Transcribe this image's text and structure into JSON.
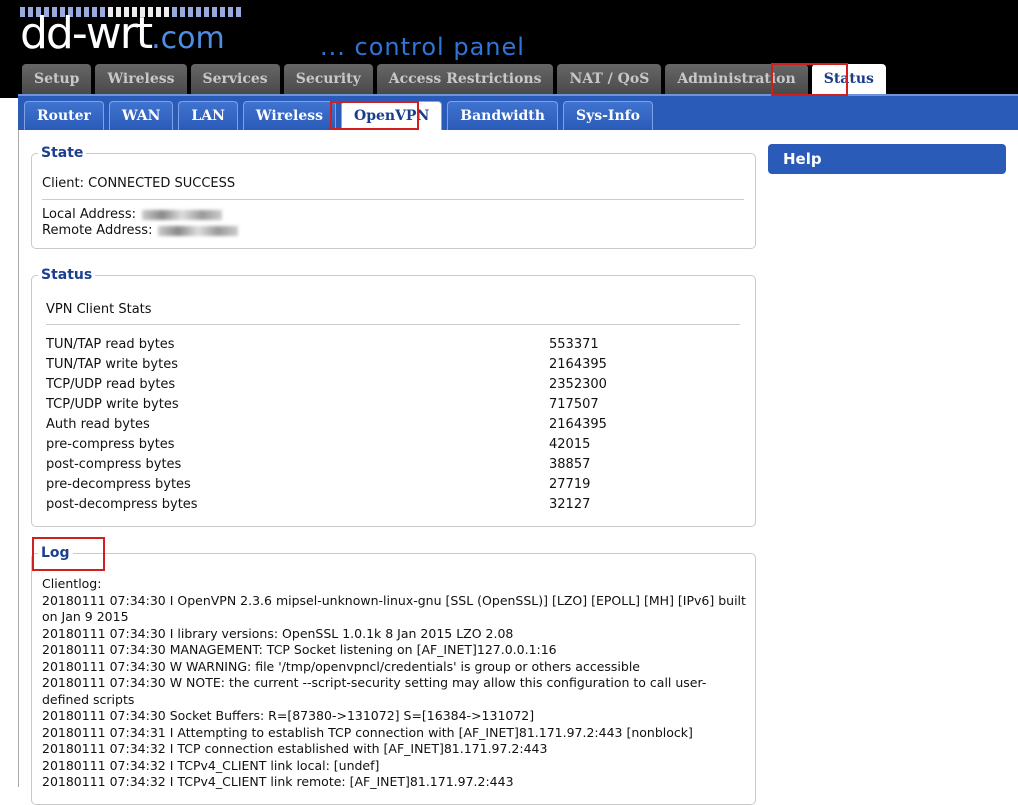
{
  "brand": {
    "logo_main": "dd-wrt",
    "logo_suffix": ".com",
    "tagline": "... control panel",
    "colors": {
      "header_bg": "#000000",
      "nav_blue": "#2b5bb8",
      "highlight_red": "#d01f1f",
      "legend_blue": "#1c3f8f"
    }
  },
  "top_tabs": [
    "Setup",
    "Wireless",
    "Services",
    "Security",
    "Access Restrictions",
    "NAT / QoS",
    "Administration",
    "Status"
  ],
  "top_active": "Status",
  "sub_tabs": [
    "Router",
    "WAN",
    "LAN",
    "Wireless",
    "OpenVPN",
    "Bandwidth",
    "Sys-Info"
  ],
  "sub_active": "OpenVPN",
  "state": {
    "legend": "State",
    "client": "Client: CONNECTED SUCCESS",
    "local_label": "Local Address:",
    "remote_label": "Remote Address:"
  },
  "status": {
    "legend": "Status",
    "heading": "VPN Client Stats",
    "rows": [
      {
        "label": "TUN/TAP read bytes",
        "value": "553371"
      },
      {
        "label": "TUN/TAP write bytes",
        "value": "2164395"
      },
      {
        "label": "TCP/UDP read bytes",
        "value": "2352300"
      },
      {
        "label": "TCP/UDP write bytes",
        "value": "717507"
      },
      {
        "label": "Auth read bytes",
        "value": "2164395"
      },
      {
        "label": "pre-compress bytes",
        "value": "42015"
      },
      {
        "label": "post-compress bytes",
        "value": "38857"
      },
      {
        "label": "pre-decompress bytes",
        "value": "27719"
      },
      {
        "label": "post-decompress bytes",
        "value": "32127"
      }
    ]
  },
  "log": {
    "legend": "Log",
    "title": "Clientlog:",
    "lines": [
      "20180111 07:34:30 I OpenVPN 2.3.6 mipsel-unknown-linux-gnu [SSL (OpenSSL)] [LZO] [EPOLL] [MH] [IPv6] built on Jan 9 2015",
      "20180111 07:34:30 I library versions: OpenSSL 1.0.1k 8 Jan 2015 LZO 2.08",
      "20180111 07:34:30 MANAGEMENT: TCP Socket listening on [AF_INET]127.0.0.1:16",
      "20180111 07:34:30 W WARNING: file '/tmp/openvpncl/credentials' is group or others accessible",
      "20180111 07:34:30 W NOTE: the current --script-security setting may allow this configuration to call user-defined scripts",
      "20180111 07:34:30 Socket Buffers: R=[87380->131072] S=[16384->131072]",
      "20180111 07:34:31 I Attempting to establish TCP connection with [AF_INET]81.171.97.2:443 [nonblock]",
      "20180111 07:34:32 I TCP connection established with [AF_INET]81.171.97.2:443",
      "20180111 07:34:32 I TCPv4_CLIENT link local: [undef]",
      "20180111 07:34:32 I TCPv4_CLIENT link remote: [AF_INET]81.171.97.2:443"
    ]
  },
  "help": {
    "title": "Help"
  }
}
